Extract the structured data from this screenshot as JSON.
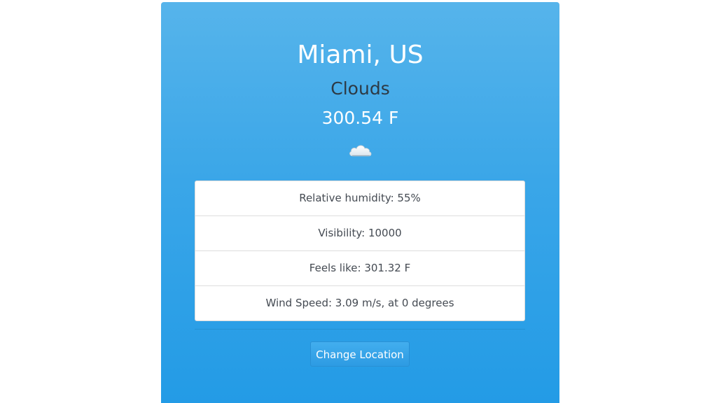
{
  "weather": {
    "location": "Miami, US",
    "condition": "Clouds",
    "temperature": "300.54 F",
    "icon": "cloud-icon"
  },
  "details": [
    {
      "label": "Relative humidity: 55%"
    },
    {
      "label": "Visibility: 10000"
    },
    {
      "label": "Feels like: 301.32 F"
    },
    {
      "label": "Wind Speed: 3.09 m/s, at 0 degrees"
    }
  ],
  "actions": {
    "change_location_label": "Change Location"
  },
  "colors": {
    "card_top": "#56b4eb",
    "card_bottom": "#239be6",
    "condition_text": "#2d3a45"
  }
}
